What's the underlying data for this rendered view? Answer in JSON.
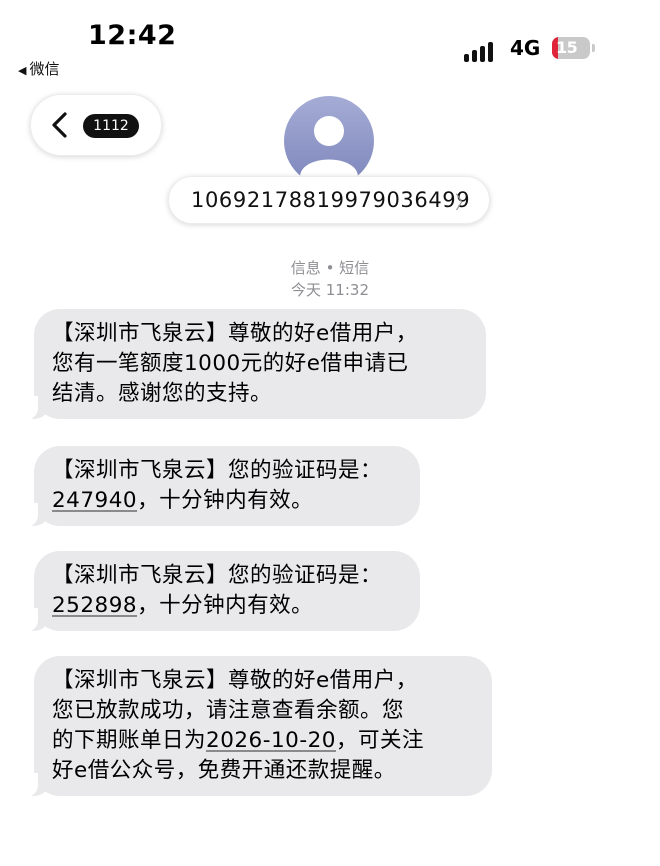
{
  "status_bar": {
    "time": "12:42",
    "back_app_label": "微信",
    "network": "4G",
    "battery": "15",
    "battery_level": 0.15
  },
  "nav": {
    "unread_count": "1112",
    "sender_number": "10692178819979036499"
  },
  "conversation": {
    "service_label": "信息 • 短信",
    "timestamp": "今天 11:32"
  },
  "messages": [
    {
      "lines": [
        "【深圳市飞泉云】尊敬的好e借用户，",
        "您有一笔额度1000元的好e借申请已",
        "结清。感谢您的支持。"
      ]
    },
    {
      "line1": "【深圳市飞泉云】您的验证码是：",
      "code": "247940",
      "suffix": "，十分钟内有效。"
    },
    {
      "line1": "【深圳市飞泉云】您的验证码是：",
      "code": "252898",
      "suffix": "，十分钟内有效。"
    },
    {
      "line1": "【深圳市飞泉云】尊敬的好e借用户，",
      "line2": "您已放款成功，请注意查看余额。您",
      "line3_prefix": "的下期账单日为",
      "date": "2026-10-20",
      "line3_suffix": "，可关注",
      "line4": "好e借公众号，免费开通还款提醒。"
    }
  ],
  "colors": {
    "bubble": "#e9e9eb",
    "battery_low": "#e0243a",
    "avatar": "#8d94c8",
    "secondary_text": "#8e8e93"
  }
}
